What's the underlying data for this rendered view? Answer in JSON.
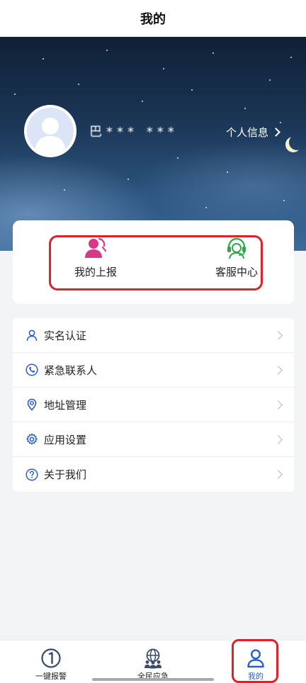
{
  "header": {
    "title": "我的"
  },
  "profile": {
    "username": "巴*** ***",
    "info_link": "个人信息"
  },
  "quick_actions": [
    {
      "label": "我的上报",
      "icon": "person-report-icon",
      "color": "#d63a86"
    },
    {
      "label": "客服中心",
      "icon": "headset-service-icon",
      "color": "#2fa64a"
    }
  ],
  "menu": {
    "items": [
      {
        "label": "实名认证",
        "icon": "person-icon"
      },
      {
        "label": "紧急联系人",
        "icon": "phone-icon"
      },
      {
        "label": "地址管理",
        "icon": "location-pin-icon"
      },
      {
        "label": "应用设置",
        "icon": "gear-icon"
      },
      {
        "label": "关于我们",
        "icon": "question-icon"
      }
    ]
  },
  "bottom_nav": {
    "items": [
      {
        "label": "一键报警",
        "icon": "alarm-icon",
        "active": false
      },
      {
        "label": "全民应急",
        "icon": "community-globe-icon",
        "active": false
      },
      {
        "label": "我的",
        "icon": "person-icon",
        "active": true
      }
    ]
  },
  "colors": {
    "accent_blue": "#2a5fc4",
    "highlight_red": "#e0202a",
    "report_pink": "#d63a86",
    "service_green": "#2fa64a"
  }
}
